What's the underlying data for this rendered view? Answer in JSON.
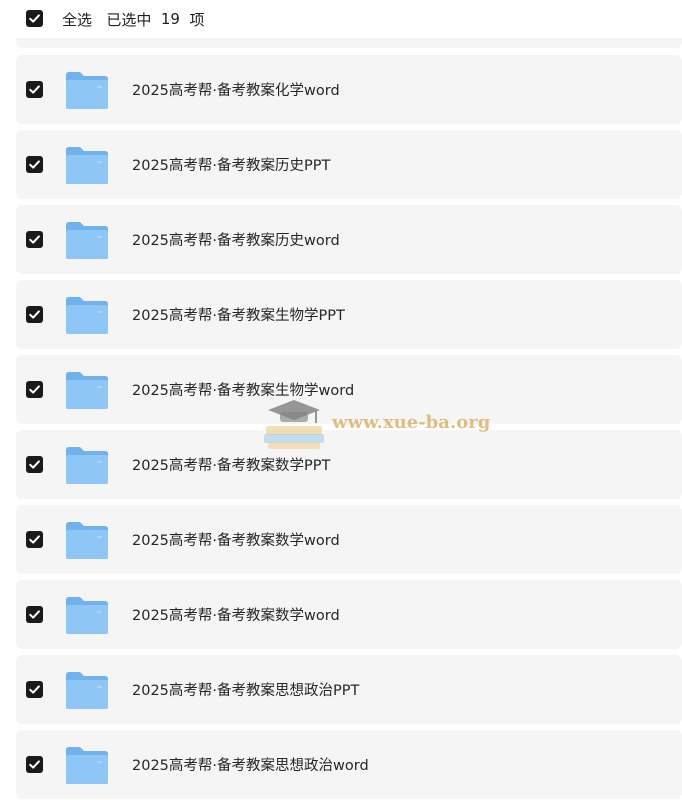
{
  "header": {
    "select_all_label": "全选",
    "selected_prefix": "已选中",
    "selected_count": "19",
    "selected_suffix": "项",
    "checked": true
  },
  "files": [
    {
      "name": "2025高考帮·备考教案化学word",
      "checked": true
    },
    {
      "name": "2025高考帮·备考教案历史PPT",
      "checked": true
    },
    {
      "name": "2025高考帮·备考教案历史word",
      "checked": true
    },
    {
      "name": "2025高考帮·备考教案生物学PPT",
      "checked": true
    },
    {
      "name": "2025高考帮·备考教案生物学word",
      "checked": true
    },
    {
      "name": "2025高考帮·备考教案数学PPT",
      "checked": true
    },
    {
      "name": "2025高考帮·备考教案数学word",
      "checked": true
    },
    {
      "name": "2025高考帮·备考教案数学word",
      "checked": true
    },
    {
      "name": "2025高考帮·备考教案思想政治PPT",
      "checked": true
    },
    {
      "name": "2025高考帮·备考教案思想政治word",
      "checked": true
    }
  ],
  "watermark": {
    "text": "www.xue-ba.org"
  },
  "colors": {
    "checkbox": "#1a1a1a",
    "row_background": "#f5f5f5",
    "folder_front": "#8ec6f5",
    "folder_back": "#6fb2ee"
  },
  "icons": {
    "folder": "folder-icon",
    "checkbox": "checkmark-icon"
  }
}
